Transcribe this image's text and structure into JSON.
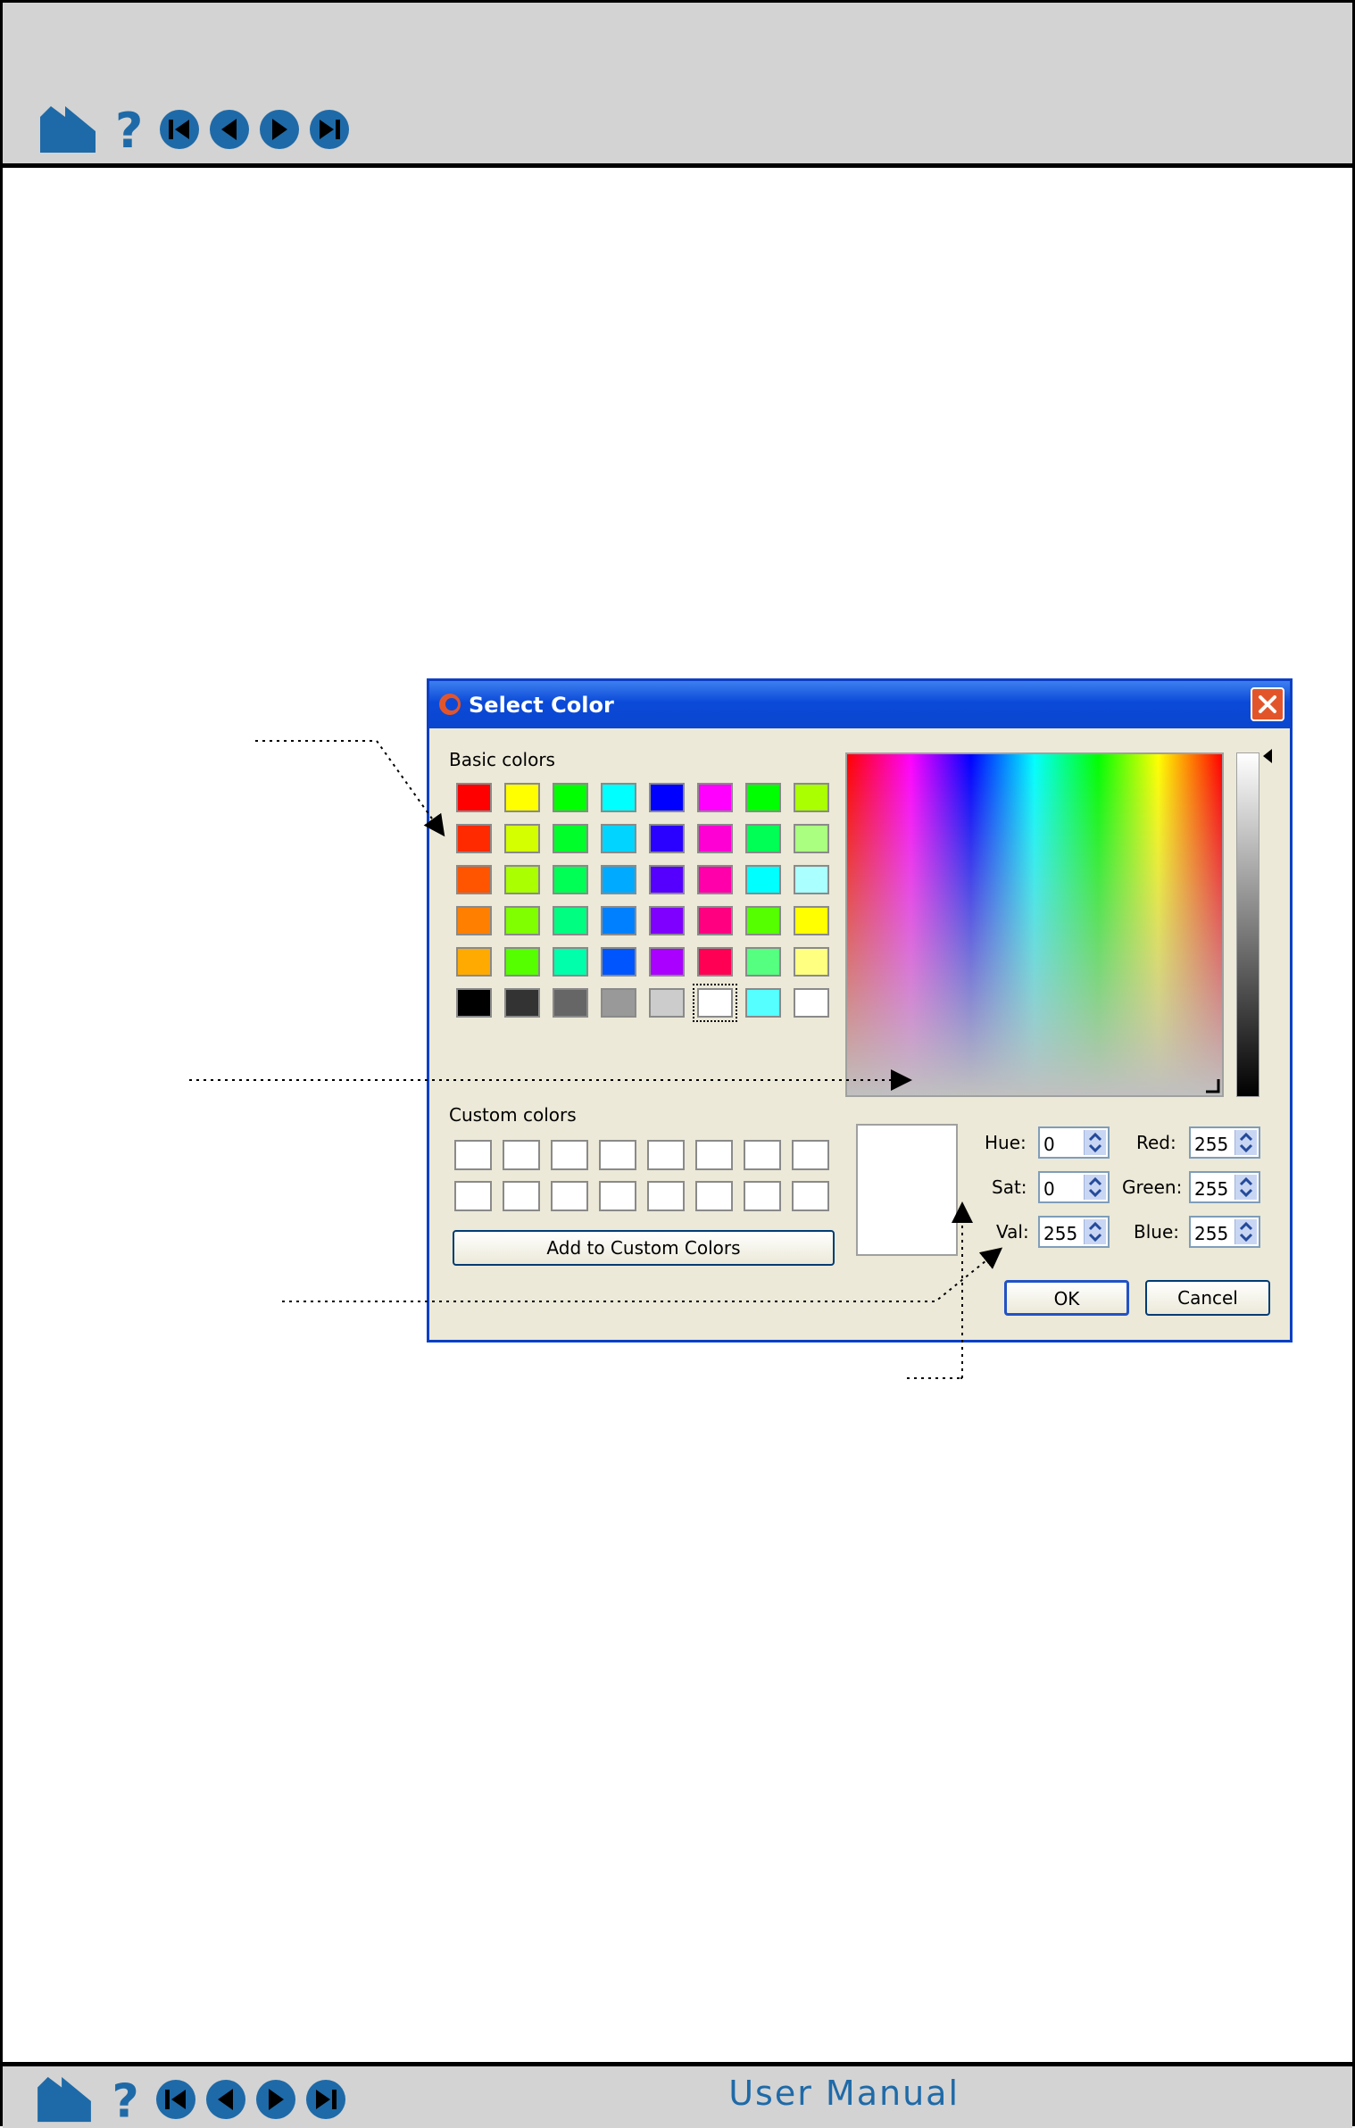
{
  "footer": {
    "title": "User Manual"
  },
  "nav": {
    "icons": [
      "home-icon",
      "help-icon",
      "first-page-icon",
      "previous-page-icon",
      "next-page-icon",
      "last-page-icon"
    ]
  },
  "dialog": {
    "title": "Select Color",
    "basic_colors_label": "Basic colors",
    "custom_colors_label": "Custom colors",
    "add_button": "Add to Custom Colors",
    "ok_button": "OK",
    "cancel_button": "Cancel",
    "hue_label": "Hue:",
    "sat_label": "Sat:",
    "val_label": "Val:",
    "red_label": "Red:",
    "green_label": "Green:",
    "blue_label": "Blue:",
    "hue": "0",
    "sat": "0",
    "val": "255",
    "red": "255",
    "green": "255",
    "blue": "255",
    "basic_colors": [
      [
        "#ff0000",
        "#ffff00",
        "#00ff00",
        "#00ffff",
        "#0000ff",
        "#ff00ff",
        "#00ff00",
        "#aaff00"
      ],
      [
        "#ff2a00",
        "#d4ff00",
        "#00ff2a",
        "#00d4ff",
        "#2a00ff",
        "#ff00d4",
        "#00ff55",
        "#aaff80"
      ],
      [
        "#ff5500",
        "#aaff00",
        "#00ff55",
        "#00aaff",
        "#5500ff",
        "#ff00aa",
        "#00ffff",
        "#aaffff"
      ],
      [
        "#ff8000",
        "#80ff00",
        "#00ff80",
        "#0080ff",
        "#8000ff",
        "#ff0080",
        "#55ff00",
        "#ffff00"
      ],
      [
        "#ffaa00",
        "#55ff00",
        "#00ffaa",
        "#0055ff",
        "#aa00ff",
        "#ff0055",
        "#55ff80",
        "#ffff80"
      ],
      [
        "#000000",
        "#333333",
        "#666666",
        "#999999",
        "#cccccc",
        "#ffffff",
        "#55ffff",
        "#ffffff"
      ]
    ],
    "selected_swatch": [
      5,
      5
    ]
  }
}
